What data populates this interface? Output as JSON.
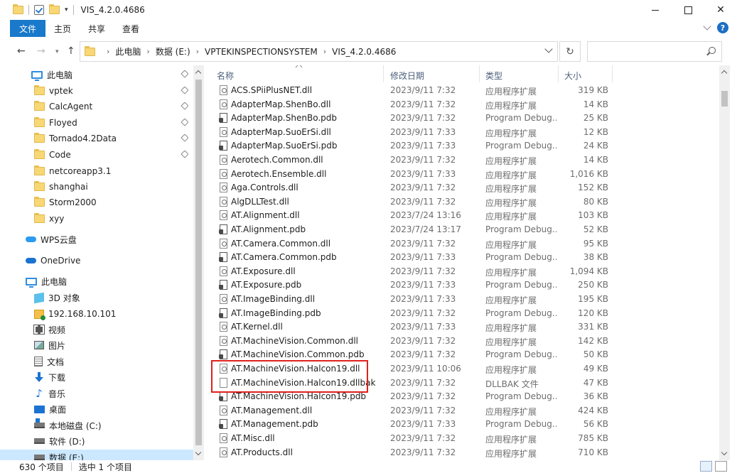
{
  "titlebar": {
    "title": "VIS_4.2.0.4686",
    "minimize_icon": "minimize-icon",
    "maximize_icon": "maximize-icon",
    "close_label": "✕"
  },
  "ribbon": {
    "tabs": [
      "文件",
      "主页",
      "共享",
      "查看"
    ]
  },
  "address": {
    "back": "←",
    "forward": "→",
    "up": "↑",
    "refresh": "↻",
    "crumbs": [
      "此电脑",
      "数据 (E:)",
      "VPTEKINSPECTIONSYSTEM",
      "VIS_4.2.0.4686"
    ],
    "search_placeholder": ""
  },
  "nav": {
    "items": [
      {
        "label": "此电脑",
        "icon": "pc-icon",
        "pinned": true
      },
      {
        "label": "vptek",
        "icon": "folder-icon",
        "pinned": true
      },
      {
        "label": "CalcAgent",
        "icon": "folder-icon",
        "pinned": true
      },
      {
        "label": "Floyed",
        "icon": "folder-icon",
        "pinned": true
      },
      {
        "label": "Tornado4.2Data",
        "icon": "folder-icon",
        "pinned": true
      },
      {
        "label": "Code",
        "icon": "folder-icon",
        "pinned": true
      },
      {
        "label": "netcoreapp3.1",
        "icon": "folder-icon",
        "pinned": false
      },
      {
        "label": "shanghai",
        "icon": "folder-icon",
        "pinned": false
      },
      {
        "label": "Storm2000",
        "icon": "folder-icon",
        "pinned": false
      },
      {
        "label": "xyy",
        "icon": "folder-icon",
        "pinned": false
      },
      {
        "label": "WPS云盘",
        "icon": "wps-cloud-icon",
        "pinned": false
      },
      {
        "label": "OneDrive",
        "icon": "onedrive-icon",
        "pinned": false
      },
      {
        "label": "此电脑",
        "icon": "pc-icon",
        "pinned": false
      },
      {
        "label": "3D 对象",
        "icon": "3d-objects-icon",
        "pinned": false
      },
      {
        "label": "192.168.10.101",
        "icon": "network-location-icon",
        "pinned": false
      },
      {
        "label": "视频",
        "icon": "video-icon",
        "pinned": false
      },
      {
        "label": "图片",
        "icon": "pictures-icon",
        "pinned": false
      },
      {
        "label": "文档",
        "icon": "documents-icon",
        "pinned": false
      },
      {
        "label": "下载",
        "icon": "downloads-icon",
        "pinned": false
      },
      {
        "label": "音乐",
        "icon": "music-icon",
        "pinned": false
      },
      {
        "label": "桌面",
        "icon": "desktop-icon",
        "pinned": false
      },
      {
        "label": "本地磁盘 (C:)",
        "icon": "windows-drive-icon",
        "pinned": false
      },
      {
        "label": "软件 (D:)",
        "icon": "drive-icon",
        "pinned": false
      },
      {
        "label": "数据 (E:)",
        "icon": "drive-icon",
        "pinned": false,
        "selected": true
      }
    ]
  },
  "list": {
    "headers": {
      "name": "名称",
      "date": "修改日期",
      "type": "类型",
      "size": "大小"
    },
    "rows": [
      {
        "name": "ACS.SPiiPlusNET.dll",
        "date": "2023/9/11 7:32",
        "type": "应用程序扩展",
        "size": "319 KB",
        "kind": "dll"
      },
      {
        "name": "AdapterMap.ShenBo.dll",
        "date": "2023/9/11 7:32",
        "type": "应用程序扩展",
        "size": "14 KB",
        "kind": "dll"
      },
      {
        "name": "AdapterMap.ShenBo.pdb",
        "date": "2023/9/11 7:32",
        "type": "Program Debug...",
        "size": "25 KB",
        "kind": "pdb"
      },
      {
        "name": "AdapterMap.SuoErSi.dll",
        "date": "2023/9/11 7:33",
        "type": "应用程序扩展",
        "size": "12 KB",
        "kind": "dll"
      },
      {
        "name": "AdapterMap.SuoErSi.pdb",
        "date": "2023/9/11 7:33",
        "type": "Program Debug...",
        "size": "24 KB",
        "kind": "pdb"
      },
      {
        "name": "Aerotech.Common.dll",
        "date": "2023/9/11 7:32",
        "type": "应用程序扩展",
        "size": "14 KB",
        "kind": "dll"
      },
      {
        "name": "Aerotech.Ensemble.dll",
        "date": "2023/9/11 7:33",
        "type": "应用程序扩展",
        "size": "1,016 KB",
        "kind": "dll"
      },
      {
        "name": "Aga.Controls.dll",
        "date": "2023/9/11 7:32",
        "type": "应用程序扩展",
        "size": "152 KB",
        "kind": "dll"
      },
      {
        "name": "AlgDLLTest.dll",
        "date": "2023/9/11 7:32",
        "type": "应用程序扩展",
        "size": "80 KB",
        "kind": "dll"
      },
      {
        "name": "AT.Alignment.dll",
        "date": "2023/7/24 13:16",
        "type": "应用程序扩展",
        "size": "103 KB",
        "kind": "dll"
      },
      {
        "name": "AT.Alignment.pdb",
        "date": "2023/7/24 13:17",
        "type": "Program Debug...",
        "size": "52 KB",
        "kind": "pdb"
      },
      {
        "name": "AT.Camera.Common.dll",
        "date": "2023/9/11 7:32",
        "type": "应用程序扩展",
        "size": "95 KB",
        "kind": "dll"
      },
      {
        "name": "AT.Camera.Common.pdb",
        "date": "2023/9/11 7:33",
        "type": "Program Debug...",
        "size": "38 KB",
        "kind": "pdb"
      },
      {
        "name": "AT.Exposure.dll",
        "date": "2023/9/11 7:32",
        "type": "应用程序扩展",
        "size": "1,094 KB",
        "kind": "dll"
      },
      {
        "name": "AT.Exposure.pdb",
        "date": "2023/9/11 7:33",
        "type": "Program Debug...",
        "size": "250 KB",
        "kind": "pdb"
      },
      {
        "name": "AT.ImageBinding.dll",
        "date": "2023/9/11 7:33",
        "type": "应用程序扩展",
        "size": "195 KB",
        "kind": "dll"
      },
      {
        "name": "AT.ImageBinding.pdb",
        "date": "2023/9/11 7:32",
        "type": "Program Debug...",
        "size": "120 KB",
        "kind": "pdb"
      },
      {
        "name": "AT.Kernel.dll",
        "date": "2023/9/11 7:33",
        "type": "应用程序扩展",
        "size": "331 KB",
        "kind": "dll"
      },
      {
        "name": "AT.MachineVision.Common.dll",
        "date": "2023/9/11 7:32",
        "type": "应用程序扩展",
        "size": "142 KB",
        "kind": "dll"
      },
      {
        "name": "AT.MachineVision.Common.pdb",
        "date": "2023/9/11 7:32",
        "type": "Program Debug...",
        "size": "50 KB",
        "kind": "pdb"
      },
      {
        "name": "AT.MachineVision.Halcon19.dll",
        "date": "2023/9/11 10:06",
        "type": "应用程序扩展",
        "size": "49 KB",
        "kind": "dll"
      },
      {
        "name": "AT.MachineVision.Halcon19.dllbak",
        "date": "2023/9/11 7:32",
        "type": "DLLBAK 文件",
        "size": "47 KB",
        "kind": "blank"
      },
      {
        "name": "AT.MachineVision.Halcon19.pdb",
        "date": "2023/9/11 7:32",
        "type": "Program Debug...",
        "size": "36 KB",
        "kind": "pdb"
      },
      {
        "name": "AT.Management.dll",
        "date": "2023/9/11 7:32",
        "type": "应用程序扩展",
        "size": "424 KB",
        "kind": "dll"
      },
      {
        "name": "AT.Management.pdb",
        "date": "2023/9/11 7:33",
        "type": "Program Debug...",
        "size": "56 KB",
        "kind": "pdb"
      },
      {
        "name": "AT.Misc.dll",
        "date": "2023/9/11 7:32",
        "type": "应用程序扩展",
        "size": "785 KB",
        "kind": "dll"
      },
      {
        "name": "AT.Products.dll",
        "date": "2023/9/11 7:32",
        "type": "应用程序扩展",
        "size": "710 KB",
        "kind": "dll"
      }
    ]
  },
  "status": {
    "item_count": "630 个项目",
    "selection": "选中 1 个项目"
  },
  "colors": {
    "accent": "#1979ca",
    "highlight_box": "#e0201c",
    "selected_nav": "#cce8ff"
  }
}
